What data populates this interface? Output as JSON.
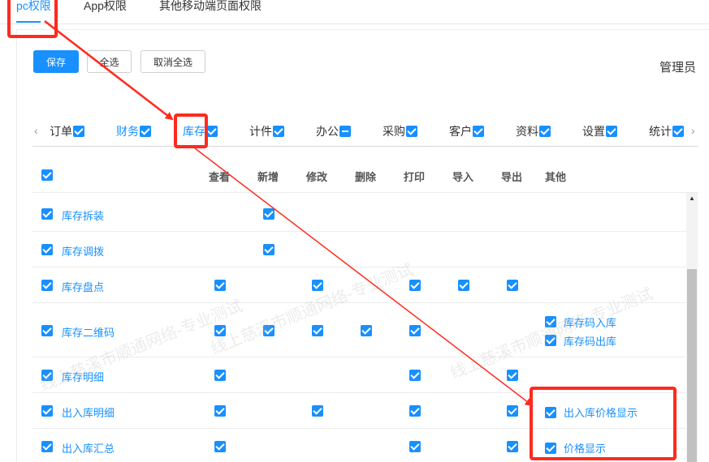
{
  "top_tabs": [
    {
      "label": "pc权限",
      "active": true
    },
    {
      "label": "App权限",
      "active": false
    },
    {
      "label": "其他移动端页面权限",
      "active": false
    }
  ],
  "toolbar": {
    "save_label": "保存",
    "select_all_label": "全选",
    "deselect_all_label": "取消全选"
  },
  "role_name": "管理员",
  "categories": [
    {
      "label": "订单",
      "state": "checked"
    },
    {
      "label": "财务",
      "state": "checked"
    },
    {
      "label": "库存",
      "state": "checked",
      "active": true
    },
    {
      "label": "计件",
      "state": "checked"
    },
    {
      "label": "办公",
      "state": "partial"
    },
    {
      "label": "采购",
      "state": "checked"
    },
    {
      "label": "客户",
      "state": "checked"
    },
    {
      "label": "资料",
      "state": "checked"
    },
    {
      "label": "设置",
      "state": "checked"
    },
    {
      "label": "统计",
      "state": "checked"
    }
  ],
  "columns": [
    "查看",
    "新增",
    "修改",
    "删除",
    "打印",
    "导入",
    "导出",
    "其他"
  ],
  "rows": [
    {
      "label": "库存拆装",
      "checked": [
        "新增"
      ],
      "extras": []
    },
    {
      "label": "库存调拨",
      "checked": [
        "新增"
      ],
      "extras": []
    },
    {
      "label": "库存盘点",
      "checked": [
        "查看",
        "修改",
        "打印",
        "导入",
        "导出"
      ],
      "extras": []
    },
    {
      "label": "库存二维码",
      "checked": [
        "查看",
        "新增",
        "修改",
        "删除",
        "打印"
      ],
      "extras": [
        "库存码入库",
        "库存码出库"
      ]
    },
    {
      "label": "库存明细",
      "checked": [
        "查看",
        "打印",
        "导出"
      ],
      "extras": []
    },
    {
      "label": "出入库明细",
      "checked": [
        "查看",
        "修改",
        "打印",
        "导出"
      ],
      "extras": [
        "出入库价格显示"
      ]
    },
    {
      "label": "出入库汇总",
      "checked": [
        "查看",
        "打印",
        "导出"
      ],
      "extras": [
        "价格显示"
      ]
    }
  ],
  "watermark_text": "线上慈溪市顺通网络-专业测试",
  "colors": {
    "accent": "#1890ff",
    "highlight": "#ff2a1e"
  }
}
